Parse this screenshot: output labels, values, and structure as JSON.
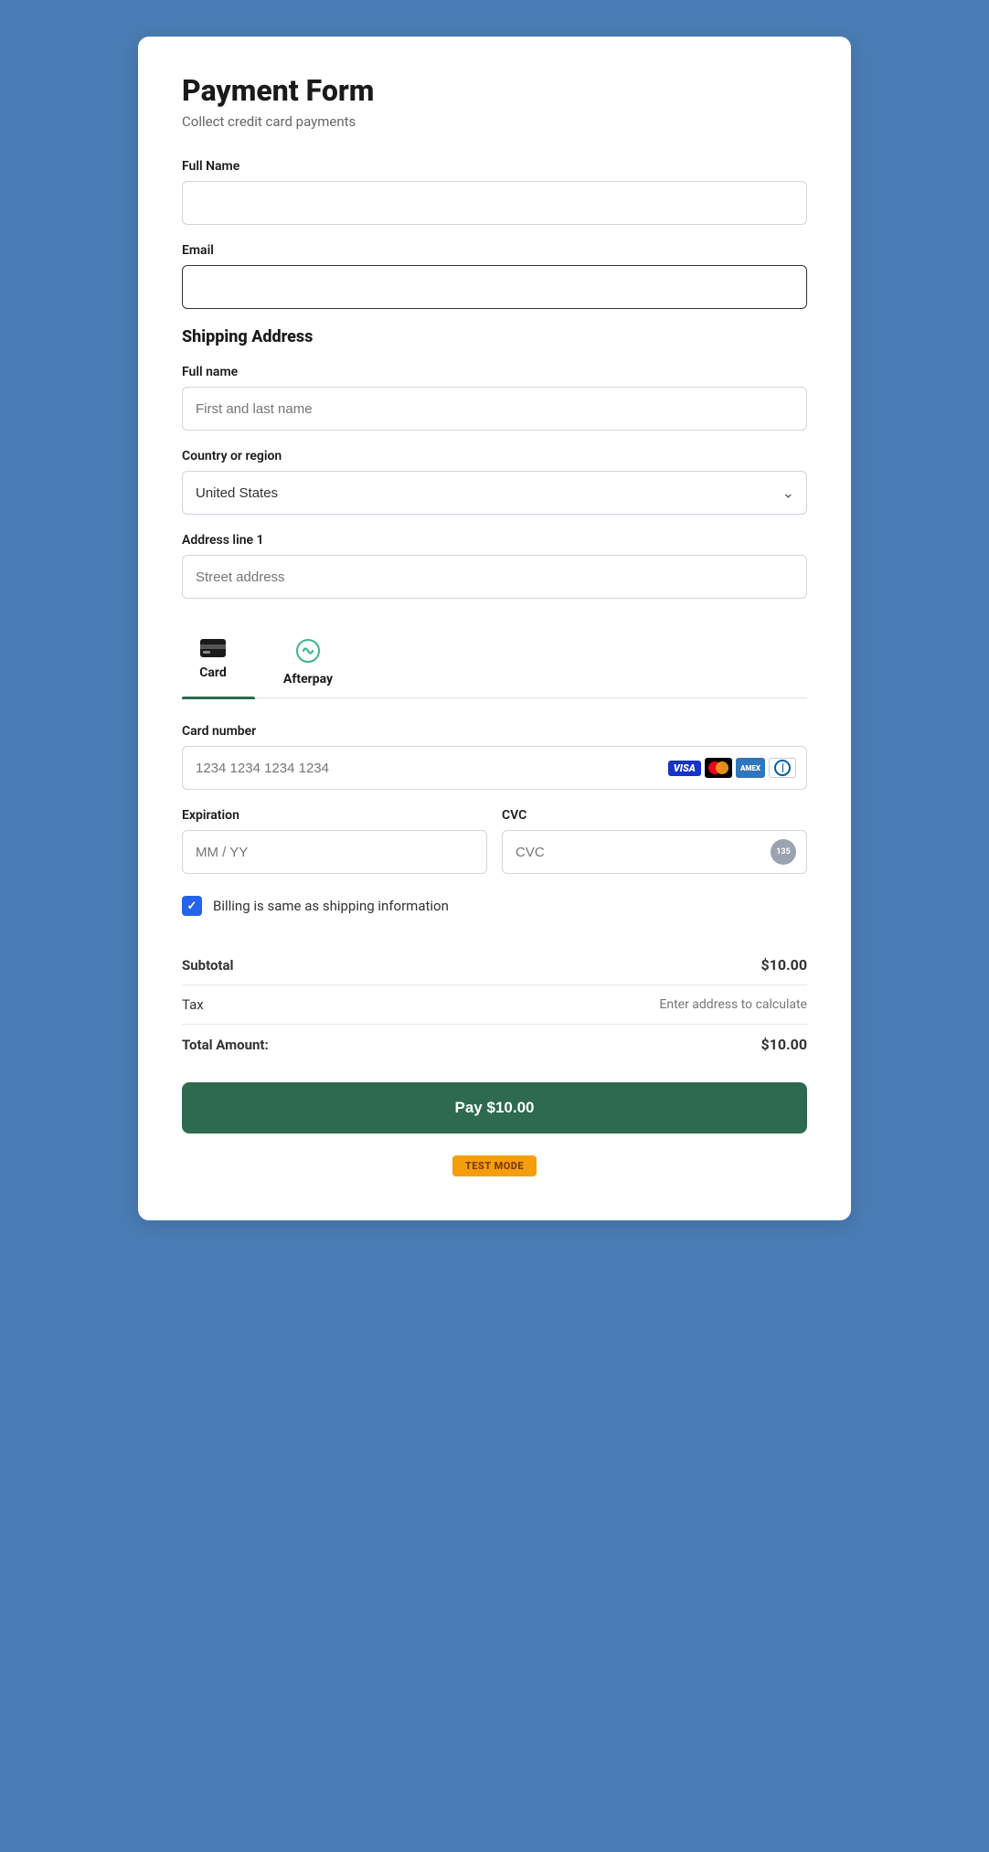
{
  "page": {
    "title": "Payment Form",
    "subtitle": "Collect credit card payments",
    "background_color": "#4a7db5"
  },
  "form": {
    "full_name_label": "Full Name",
    "full_name_placeholder": "",
    "email_label": "Email",
    "email_placeholder": "",
    "shipping_section_title": "Shipping Address",
    "shipping_name_label": "Full name",
    "shipping_name_placeholder": "First and last name",
    "country_label": "Country or region",
    "country_value": "United States",
    "address_label": "Address line 1",
    "address_placeholder": "Street address"
  },
  "payment": {
    "tabs": [
      {
        "id": "card",
        "label": "Card",
        "active": true
      },
      {
        "id": "afterpay",
        "label": "Afterpay",
        "active": false
      }
    ],
    "card_number_label": "Card number",
    "card_number_placeholder": "1234 1234 1234 1234",
    "expiration_label": "Expiration",
    "expiration_placeholder": "MM / YY",
    "cvc_label": "CVC",
    "cvc_placeholder": "CVC",
    "cvc_number": "135"
  },
  "billing": {
    "checkbox_label": "Billing is same as shipping information",
    "checked": true
  },
  "summary": {
    "subtotal_label": "Subtotal",
    "subtotal_value": "$10.00",
    "tax_label": "Tax",
    "tax_value": "Enter address to calculate",
    "total_label": "Total Amount:",
    "total_value": "$10.00"
  },
  "actions": {
    "pay_button_label": "Pay $10.00",
    "test_mode_label": "TEST MODE"
  }
}
